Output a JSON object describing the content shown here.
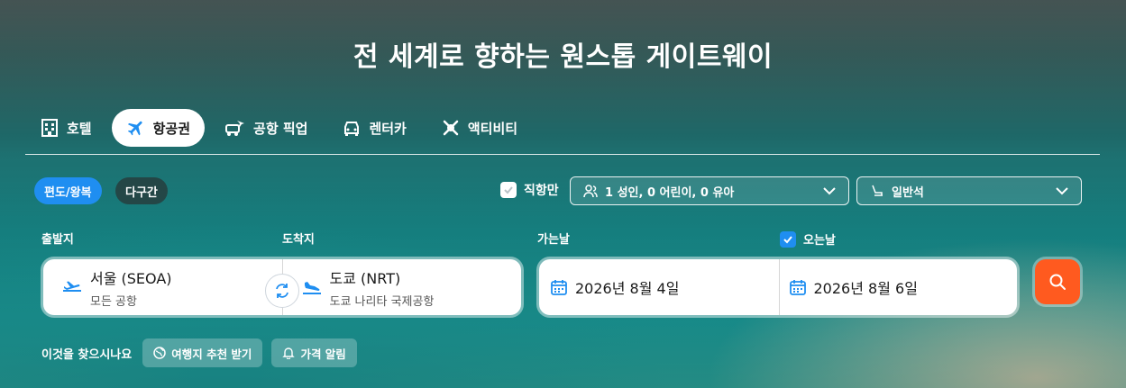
{
  "headline": "전 세계로 향하는 원스톱 게이트웨이",
  "tabs": [
    {
      "label": "호텔",
      "icon": "hotel-icon",
      "active": false
    },
    {
      "label": "항공권",
      "icon": "airplane-icon",
      "active": true
    },
    {
      "label": "공항 픽업",
      "icon": "airport-transfer-icon",
      "active": false
    },
    {
      "label": "렌터카",
      "icon": "car-icon",
      "active": false
    },
    {
      "label": "액티비티",
      "icon": "activity-icon",
      "active": false
    }
  ],
  "trip_type": {
    "oneway_roundtrip": "편도/왕복",
    "multi_city": "다구간"
  },
  "direct_only": {
    "label": "직항만",
    "checked": false
  },
  "passengers": "1 성인, 0 어린이, 0 유아",
  "cabin_class": "일반석",
  "labels": {
    "from": "출발지",
    "to": "도착지",
    "depart": "가는날",
    "return": "오는날"
  },
  "roundtrip_checked": true,
  "origin": {
    "city": "서울 (SEOA)",
    "airport": "모든 공항"
  },
  "destination": {
    "city": "도쿄 (NRT)",
    "airport": "도쿄 나리타 국제공항"
  },
  "depart_date": "2026년 8월 4일",
  "return_date": "2026년 8월 6일",
  "suggest": {
    "question": "이것을 찾으시나요",
    "recommend": "여행지 추천 받기",
    "price_alert": "가격 알림"
  },
  "colors": {
    "accent": "#1f8ef1",
    "search": "#ff5a1f"
  }
}
